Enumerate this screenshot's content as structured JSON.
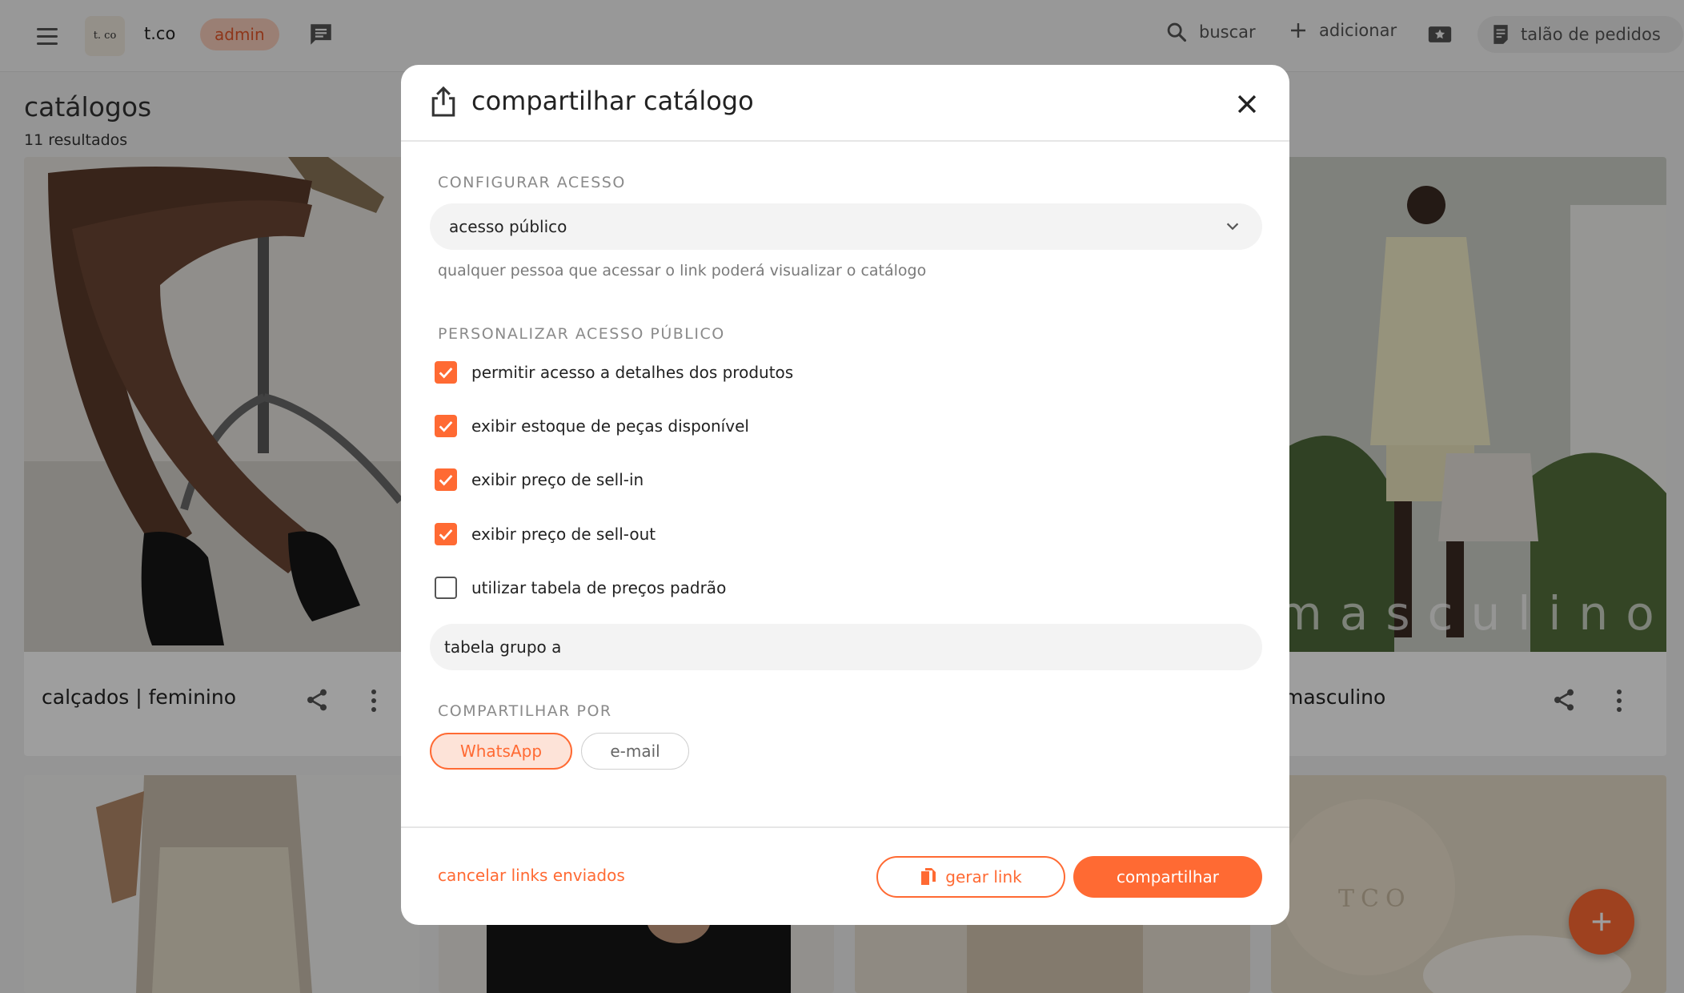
{
  "colors": {
    "accent": "#ff6a33",
    "accent_soft": "#fde3d8",
    "badge_bg": "#f9cdbb"
  },
  "topbar": {
    "brand": "t.co",
    "logo_text": "t. co",
    "badge": "admin",
    "search_label": "buscar",
    "add_label": "adicionar",
    "orders_label": "talão de pedidos"
  },
  "page": {
    "title": "catálogos",
    "subtitle": "11 resultados"
  },
  "cards": [
    {
      "title": "calçados | feminino"
    },
    {
      "title": "masculino",
      "image_overlay_text": "masculino"
    },
    {
      "image_overlay_text": "TCO"
    }
  ],
  "modal": {
    "title": "compartilhar catálogo",
    "access_section_label": "CONFIGURAR ACESSO",
    "access_value": "acesso público",
    "access_helper": "qualquer pessoa que acessar o link poderá visualizar o catálogo",
    "customize_section_label": "PERSONALIZAR ACESSO PÚBLICO",
    "options": [
      {
        "label": "permitir acesso a detalhes dos produtos",
        "checked": true
      },
      {
        "label": "exibir estoque de peças disponível",
        "checked": true
      },
      {
        "label": "exibir preço de sell-in",
        "checked": true
      },
      {
        "label": "exibir preço de sell-out",
        "checked": true
      },
      {
        "label": "utilizar tabela de preços padrão",
        "checked": false
      }
    ],
    "price_table_value": "tabela grupo a",
    "share_section_label": "COMPARTILHAR POR",
    "share_channels": [
      {
        "label": "WhatsApp",
        "selected": true
      },
      {
        "label": "e-mail",
        "selected": false
      }
    ],
    "cancel_links_label": "cancelar links enviados",
    "generate_link_label": "gerar link",
    "share_button_label": "compartilhar"
  }
}
